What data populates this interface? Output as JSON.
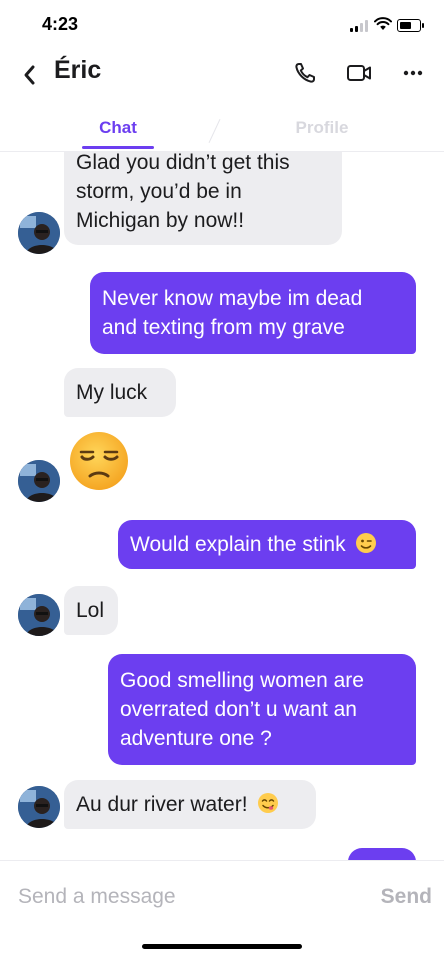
{
  "status_bar": {
    "time": "4:23"
  },
  "header": {
    "back_icon": "chevron-left-icon",
    "contact_name": "Éric",
    "actions": [
      "phone-icon",
      "video-camera-icon",
      "more-icon"
    ]
  },
  "tabs": {
    "chat": "Chat",
    "profile": "Profile",
    "active": "chat"
  },
  "colors": {
    "accent": "#6c3ef0",
    "incoming_bubble": "#ededf0",
    "muted_text": "#b4b4ba"
  },
  "messages": [
    {
      "direction": "incoming",
      "lines": [
        "Glad you didn’t get this",
        "storm, you’d be in",
        "Michigan by now!!"
      ]
    },
    {
      "direction": "outgoing",
      "lines": [
        "Never know maybe im dead",
        "and texting from my grave"
      ]
    },
    {
      "direction": "incoming",
      "lines": [
        "My luck"
      ]
    },
    {
      "direction": "incoming",
      "emoji": "unamused-face-emoji"
    },
    {
      "direction": "outgoing",
      "text": "Would explain the stink",
      "emoji": "winking-face-emoji"
    },
    {
      "direction": "incoming",
      "lines": [
        "Lol"
      ]
    },
    {
      "direction": "outgoing",
      "lines": [
        "Good smelling women are",
        "overrated don’t u want an",
        "adventure one ?"
      ]
    },
    {
      "direction": "incoming",
      "text": "Au dur river water!",
      "emoji": "yum-face-emoji"
    }
  ],
  "composer": {
    "placeholder": "Send a message",
    "value": "",
    "send_label": "Send"
  }
}
